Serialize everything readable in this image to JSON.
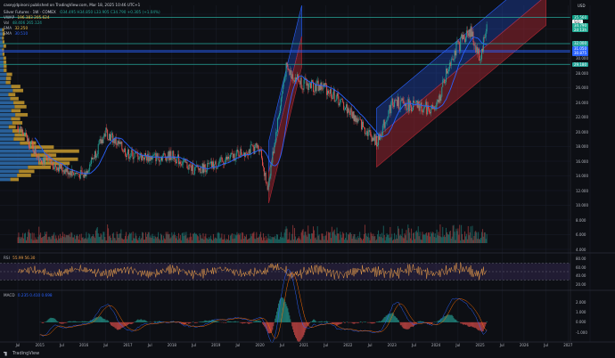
{
  "window": {
    "title_text": "caseyjdpinoni published on TradingView.com, Mar 18, 2025 10:46 UTC+1"
  },
  "legend": {
    "symbol_line": "Silver Futures · 1W · COMEX",
    "ohlc": "O34.495 H34.850 L33.905 C34.790 +0.305 (+1.04%)",
    "vwap_label": "VWAP",
    "vwap_values": "196.383 205.624",
    "vol_label": "Vol",
    "vol_values": "48.406 265.124",
    "sma1_label": "SMA",
    "sma1_value": "32.250",
    "sma2_label": "SMA",
    "sma2_value": "30.510"
  },
  "currency": "USD",
  "price_axis": [
    "34.000",
    "32.000",
    "30.000",
    "28.000",
    "26.000",
    "24.000",
    "22.000",
    "20.000",
    "18.000",
    "16.000",
    "14.000",
    "12.000",
    "10.000",
    "8.000",
    "6.000",
    "4.000"
  ],
  "price_tags": [
    {
      "label": "35.560",
      "color": "#089981"
    },
    {
      "label": "SI1!",
      "color": "#ffffff"
    },
    {
      "label": "34.790",
      "color": "#22ab94"
    },
    {
      "label": "2d 13h",
      "color": "#22ab94"
    },
    {
      "label": "32.000",
      "color": "#26a69a"
    },
    {
      "label": "31.050",
      "color": "#2962ff"
    },
    {
      "label": "30.875",
      "color": "#2962ff"
    },
    {
      "label": "29.180",
      "color": "#26a69a"
    }
  ],
  "rsi": {
    "label": "RSI",
    "values": "55.99 56.30",
    "axis": [
      "80.00",
      "60.00",
      "40.00",
      "20.00"
    ]
  },
  "macd": {
    "label": "MACD",
    "values": "0.235 0.410 0.698",
    "axis": [
      "2.000",
      "1.000",
      "0.000",
      "-1.000"
    ]
  },
  "time_axis": [
    "Jul",
    "2015",
    "Jul",
    "2016",
    "Jul",
    "2017",
    "Jul",
    "2018",
    "Jul",
    "2019",
    "Jul",
    "2020",
    "Jul",
    "2021",
    "Jul",
    "2022",
    "Jul",
    "2023",
    "Jul",
    "2024",
    "Jul",
    "2025",
    "Jul",
    "2026",
    "Jul",
    "2027"
  ],
  "watermark": "TradingView",
  "colors": {
    "up": "#26a69a",
    "down": "#ef5350",
    "ma": "#2962ff",
    "channel_blue": "#2962ff",
    "channel_red": "#b22833",
    "rsi_line": "#f0a24a",
    "rsi_band": "#7e57c2",
    "vpvr_blue": "#2f6fb0",
    "vpvr_yellow": "#c89a2e"
  },
  "chart_data": {
    "type": "line",
    "title": "Silver Futures · 1W · COMEX",
    "x": [
      "2014-07",
      "2015-01",
      "2015-07",
      "2016-01",
      "2016-07",
      "2017-01",
      "2017-07",
      "2018-01",
      "2018-07",
      "2019-01",
      "2019-07",
      "2020-01",
      "2020-03",
      "2020-08",
      "2021-01",
      "2021-07",
      "2022-01",
      "2022-09",
      "2023-01",
      "2023-07",
      "2024-01",
      "2024-05",
      "2024-10",
      "2025-01",
      "2025-03"
    ],
    "series": [
      {
        "name": "Silver Futures",
        "values": [
          20.8,
          16.5,
          15.0,
          14.0,
          20.0,
          17.0,
          16.5,
          16.8,
          14.8,
          15.5,
          17.0,
          18.0,
          12.0,
          28.5,
          26.5,
          26.0,
          23.0,
          18.5,
          24.0,
          23.5,
          23.0,
          30.0,
          34.0,
          30.0,
          34.79
        ]
      }
    ],
    "ylim": [
      4,
      36
    ],
    "xlabel": "",
    "ylabel": ""
  }
}
